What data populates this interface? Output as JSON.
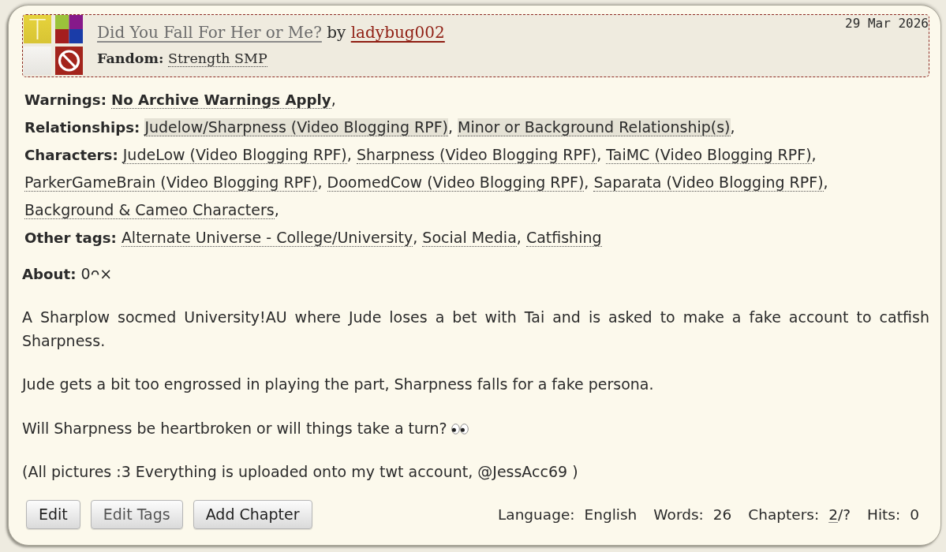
{
  "header": {
    "rating": "T",
    "title": "Did You Fall For Her or Me?",
    "byline": "by",
    "author": "ladybug002",
    "date": "29 Mar 2026",
    "fandom_label": "Fandom:",
    "fandoms": [
      "Strength SMP"
    ]
  },
  "tag_groups": [
    {
      "kind": "warnings",
      "label": "Warnings:",
      "tags": [
        {
          "label": "No Archive Warnings Apply",
          "separator": ","
        }
      ]
    },
    {
      "kind": "relationships",
      "label": "Relationships:",
      "tags": [
        {
          "label": "Judelow/Sharpness (Video Blogging RPF)",
          "separator": ","
        },
        {
          "label": "Minor or Background Relationship(s)",
          "separator": ","
        }
      ]
    },
    {
      "kind": "characters",
      "label": "Characters:",
      "tags": [
        {
          "label": "JudeLow (Video Blogging RPF)",
          "separator": ","
        },
        {
          "label": "Sharpness (Video Blogging RPF)",
          "separator": ","
        },
        {
          "label": "TaiMC (Video Blogging RPF)",
          "separator": ","
        },
        {
          "label": "ParkerGameBrain (Video Blogging RPF)",
          "separator": ","
        },
        {
          "label": "DoomedCow (Video Blogging RPF)",
          "separator": ","
        },
        {
          "label": "Saparata (Video Blogging RPF)",
          "separator": ","
        },
        {
          "label": "Background & Cameo Characters",
          "separator": ","
        }
      ]
    },
    {
      "kind": "freeforms",
      "label": "Other tags:",
      "tags": [
        {
          "label": "Alternate Universe - College/University",
          "separator": ","
        },
        {
          "label": "Social Media",
          "separator": ","
        },
        {
          "label": "Catfishing"
        }
      ]
    }
  ],
  "summary": {
    "label": "About:",
    "text": "0ᴖ×",
    "paragraphs": [
      {
        "kind": "text",
        "text": "A Sharplow socmed University!AU where Jude loses a bet with Tai and is asked to make a fake account to catfish Sharpness."
      },
      {
        "kind": "text",
        "text": "Jude gets a bit too engrossed in playing the part, Sharpness falls for a fake persona."
      },
      {
        "kind": "emoji",
        "text": "Will Sharpness be heartbroken or will things take a turn?"
      },
      {
        "kind": "text",
        "text": "(All pictures :3 Everything is uploaded onto my twt account, @JessAcc69 )"
      }
    ]
  },
  "buttons": [
    {
      "label": "Edit",
      "disabled": false
    },
    {
      "label": "Edit Tags",
      "disabled": true
    },
    {
      "label": "Add Chapter",
      "disabled": false
    }
  ],
  "stats": [
    {
      "label": "Language:",
      "value": "English"
    },
    {
      "label": "Words:",
      "value": "26"
    },
    {
      "label": "Chapters:",
      "link": "2",
      "value": "/?"
    },
    {
      "label": "Hits:",
      "value": "0"
    }
  ]
}
